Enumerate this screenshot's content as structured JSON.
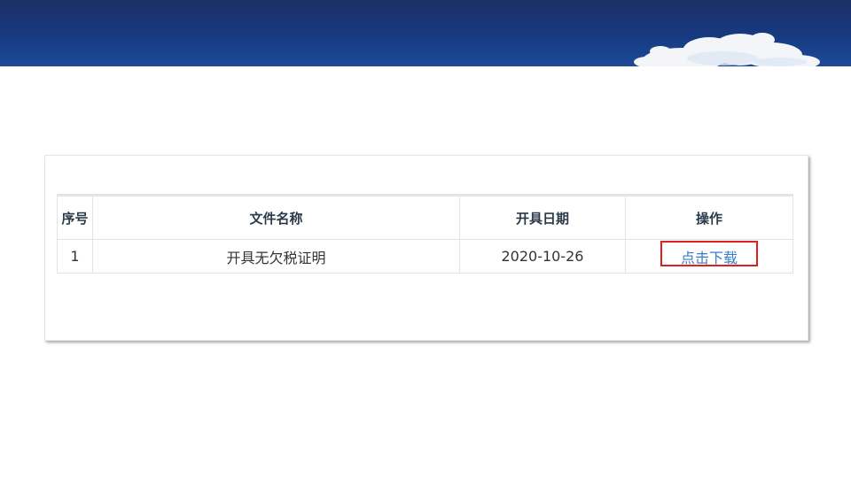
{
  "table": {
    "headers": [
      "序号",
      "文件名称",
      "开具日期",
      "操作"
    ],
    "rows": [
      {
        "index": "1",
        "file_name": "开具无欠税证明",
        "date": "2020-10-26",
        "action": "点击下载"
      }
    ]
  },
  "colors": {
    "banner": "#173a80",
    "link": "#3a7cc6",
    "highlight": "#e02020"
  },
  "icons": {
    "banner_decoration": "cloud"
  }
}
